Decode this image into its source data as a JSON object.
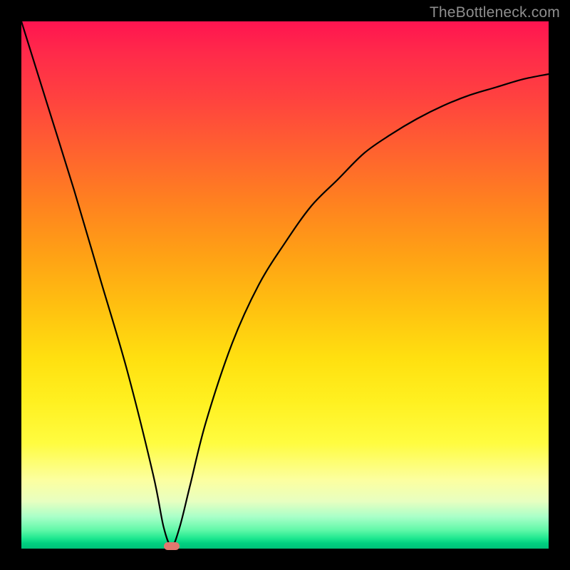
{
  "watermark": "TheBottleneck.com",
  "colors": {
    "frame": "#000000",
    "marker": "#e2786f",
    "curve": "#000000"
  },
  "chart_data": {
    "type": "line",
    "title": "",
    "xlabel": "",
    "ylabel": "",
    "xlim": [
      0,
      100
    ],
    "ylim": [
      0,
      100
    ],
    "grid": false,
    "legend": false,
    "series": [
      {
        "name": "curve",
        "x": [
          0,
          5,
          10,
          15,
          20,
          25,
          27,
          28.5,
          30,
          32,
          35,
          40,
          45,
          50,
          55,
          60,
          65,
          70,
          75,
          80,
          85,
          90,
          95,
          100
        ],
        "y": [
          100,
          84,
          68,
          51,
          34,
          14,
          4,
          0.5,
          4,
          12,
          24,
          39,
          50,
          58,
          65,
          70,
          75,
          78.5,
          81.5,
          84,
          86,
          87.5,
          89,
          90
        ]
      }
    ],
    "marker": {
      "x": 28.5,
      "y": 0.5
    },
    "background_gradient": [
      {
        "pos": 0,
        "color": "#ff1450"
      },
      {
        "pos": 50,
        "color": "#ffc010"
      },
      {
        "pos": 82,
        "color": "#fffc60"
      },
      {
        "pos": 100,
        "color": "#00c878"
      }
    ]
  }
}
